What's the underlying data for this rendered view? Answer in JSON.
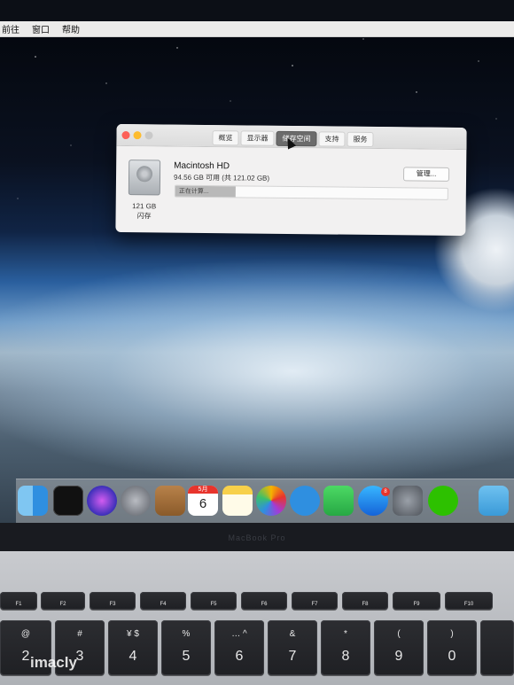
{
  "menubar": {
    "items": [
      "前往",
      "窗口",
      "帮助"
    ]
  },
  "about_window": {
    "tabs": [
      "概览",
      "显示器",
      "储存空间",
      "支持",
      "服务"
    ],
    "active_tab": "储存空间",
    "disk": {
      "name": "Macintosh HD",
      "available": "94.56 GB 可用 (共 121.02 GB)",
      "capacity": "121 GB",
      "type": "闪存",
      "status": "正在计算...",
      "bar_fill_fraction": 0.22
    },
    "manage_button": "管理..."
  },
  "dock": {
    "calendar_month": "5月",
    "calendar_day": "6",
    "appstore_badge": "8",
    "icons": [
      "finder-icon",
      "activity-monitor-icon",
      "siri-icon",
      "launchpad-icon",
      "contacts-icon",
      "calendar-icon",
      "notes-icon",
      "photos-icon",
      "messages-icon",
      "facetime-icon",
      "app-store-icon",
      "system-preferences-icon",
      "wechat-icon",
      "downloads-folder-icon"
    ]
  },
  "laptop": {
    "brand": "MacBook Pro",
    "fkeys": [
      "F1",
      "F2",
      "F3",
      "F4",
      "F5",
      "F6",
      "F7",
      "F8",
      "F9",
      "F10"
    ],
    "number_keys": [
      {
        "sym": "@",
        "num": "2"
      },
      {
        "sym": "#",
        "num": "3"
      },
      {
        "sym": "¥ $",
        "num": "4"
      },
      {
        "sym": "%",
        "num": "5"
      },
      {
        "sym": "… ^",
        "num": "6"
      },
      {
        "sym": "&",
        "num": "7"
      },
      {
        "sym": "*",
        "num": "8"
      },
      {
        "sym": "(",
        "num": "9"
      },
      {
        "sym": ")",
        "num": "0"
      }
    ]
  },
  "watermark": "imacly",
  "colors": {
    "close": "#fc5f57",
    "minimize": "#fdbc2e",
    "active_tab": "#6b6b6b",
    "badge": "#e8342c"
  }
}
